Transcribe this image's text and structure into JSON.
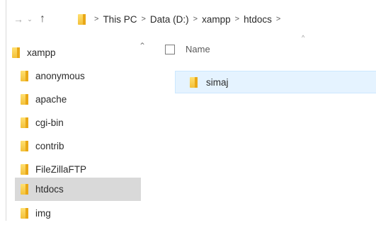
{
  "breadcrumb": {
    "items": [
      "This PC",
      "Data (D:)",
      "xampp",
      "htdocs"
    ],
    "separator": ">"
  },
  "nav": {
    "back": "←",
    "forward": "→",
    "recent": "⌄",
    "up": "↑"
  },
  "navpane": {
    "collapse": "⌃",
    "items": [
      {
        "label": "xampp"
      },
      {
        "label": "anonymous"
      },
      {
        "label": "apache"
      },
      {
        "label": "cgi-bin"
      },
      {
        "label": "contrib"
      },
      {
        "label": "FileZillaFTP"
      },
      {
        "label": "htdocs",
        "selected": true
      },
      {
        "label": "img"
      }
    ]
  },
  "content": {
    "column_name": "Name",
    "sort_indicator": "^",
    "files": [
      {
        "name": "simaj",
        "type": "folder"
      }
    ]
  },
  "colors": {
    "folder": "#f3c13a",
    "selected_nav": "#d9d9d9",
    "hover_row": "#e5f3ff"
  }
}
